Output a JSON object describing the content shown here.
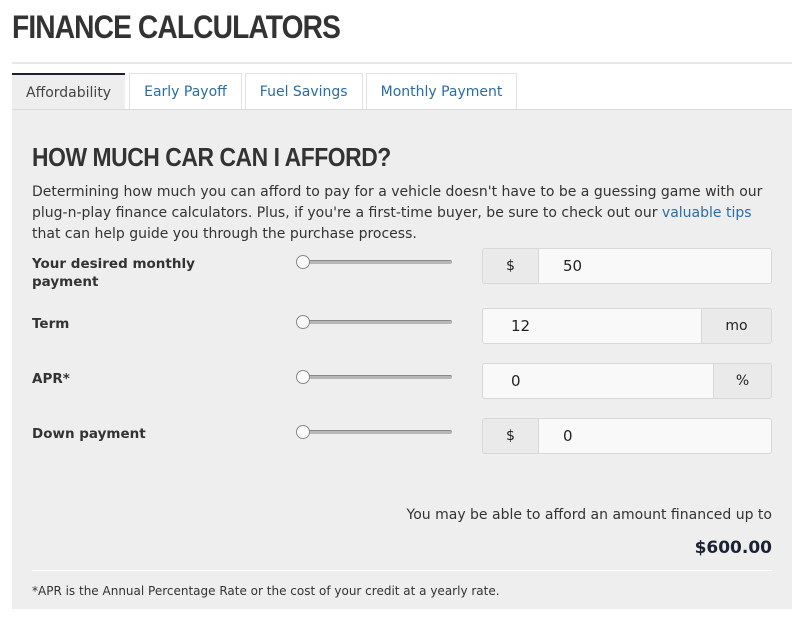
{
  "page": {
    "title": "FINANCE CALCULATORS"
  },
  "tabs": [
    {
      "label": "Affordability",
      "active": true
    },
    {
      "label": "Early Payoff",
      "active": false
    },
    {
      "label": "Fuel Savings",
      "active": false
    },
    {
      "label": "Monthly Payment",
      "active": false
    }
  ],
  "calculator": {
    "title": "HOW MUCH CAR CAN I AFFORD?",
    "intro_before_link": "Determining how much you can afford to pay for a vehicle doesn't have to be a guessing game with our plug-n-play finance calculators. Plus, if you're a first-time buyer, be sure to check out our ",
    "intro_link": "valuable tips",
    "intro_after_link": " that can help guide you through the purchase process.",
    "fields": {
      "monthly_payment": {
        "label": "Your desired monthly payment",
        "prefix": "$",
        "value": "50",
        "slider_position": 0
      },
      "term": {
        "label": "Term",
        "suffix": "mo",
        "value": "12",
        "slider_position": 0
      },
      "apr": {
        "label": "APR*",
        "suffix": "%",
        "value": "0",
        "slider_position": 0
      },
      "down_payment": {
        "label": "Down payment",
        "prefix": "$",
        "value": "0",
        "slider_position": 0
      }
    },
    "result_label": "You may be able to afford an amount financed up to",
    "result_value": "$600.00",
    "footnote": "*APR is the Annual Percentage Rate or the cost of your credit at a yearly rate."
  },
  "colors": {
    "link": "#2a6ca6",
    "active_tab_border": "#1a2233",
    "panel_bg": "#eeeeee"
  }
}
